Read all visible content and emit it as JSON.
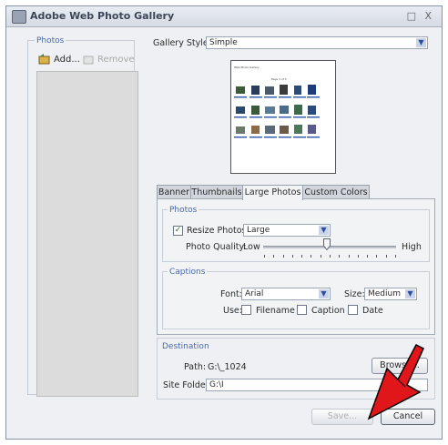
{
  "window": {
    "title": "Adobe Web Photo Gallery",
    "controls": "□ X"
  },
  "photos": {
    "group_label": "Photos",
    "add_label": "Add...",
    "remove_label": "Remove"
  },
  "gallery_style": {
    "label": "Gallery Style:",
    "value": "Simple"
  },
  "preview": {
    "header": "Web Photo Gallery",
    "pager": "Page 1 of 5"
  },
  "tabs": [
    {
      "label": "Banner"
    },
    {
      "label": "Thumbnails"
    },
    {
      "label": "Large Photos"
    },
    {
      "label": "Custom Colors"
    }
  ],
  "large_photos": {
    "group_label": "Photos",
    "resize_label": "Resize Photos:",
    "resize_checked": true,
    "resize_value": "Large",
    "quality_label": "Photo Quality:",
    "quality_low": "Low",
    "quality_high": "High",
    "quality_level": 0.48
  },
  "captions": {
    "group_label": "Captions",
    "font_label": "Font:",
    "font_value": "Arial",
    "size_label": "Size:",
    "size_value": "Medium",
    "use_label": "Use:",
    "filename_label": "Filename",
    "caption_label": "Caption",
    "date_label": "Date"
  },
  "destination": {
    "group_label": "Destination",
    "path_label": "Path:",
    "path_value": "G:\\_1024",
    "browse_label": "Browse...",
    "site_folder_label": "Site Folder:",
    "site_folder_value": "G:\\I"
  },
  "footer": {
    "save_label": "Save...",
    "cancel_label": "Cancel"
  },
  "colors": {
    "group_label": "#4a6aa8",
    "select_arrow": "#2c4c9c",
    "cursor": "#e0161b"
  }
}
